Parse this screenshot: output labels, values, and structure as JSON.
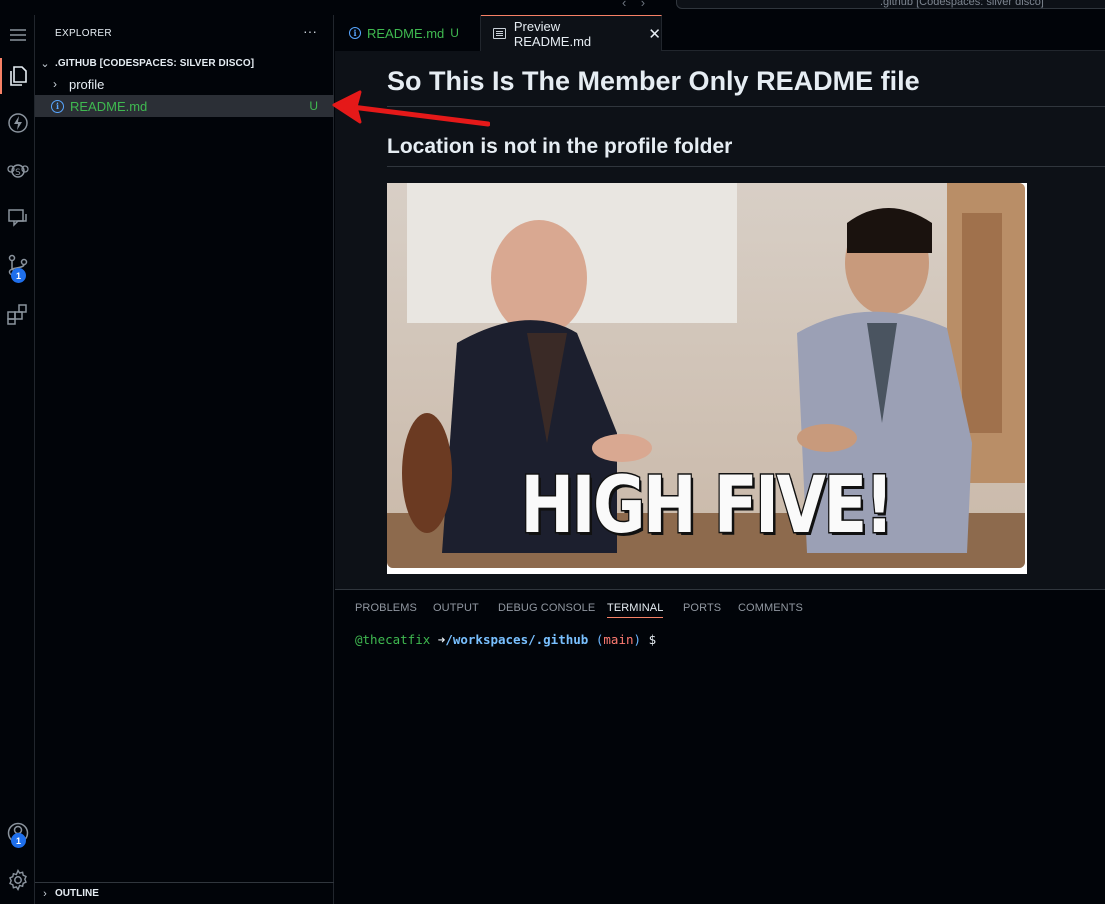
{
  "window": {
    "title_search_text": ".github [Codespaces: silver disco]"
  },
  "activity_bar": {
    "source_control_badge": "1",
    "accounts_badge": "1"
  },
  "sidebar": {
    "title": "EXPLORER",
    "more_label": "···",
    "folder_name": ".GITHUB [CODESPACES: SILVER DISCO]",
    "items": [
      {
        "label": "profile",
        "type": "folder"
      },
      {
        "label": "README.md",
        "type": "file",
        "status": "U"
      }
    ],
    "outline_label": "OUTLINE"
  },
  "tabs": [
    {
      "label": "README.md",
      "status": "U",
      "active": false
    },
    {
      "label": "Preview README.md",
      "active": true,
      "close": "✕"
    }
  ],
  "preview": {
    "h1": "So This Is The Member Only README file",
    "h2": "Location is not in the profile folder",
    "image_caption": "HIGH FIVE!"
  },
  "panel": {
    "tabs": [
      "PROBLEMS",
      "OUTPUT",
      "DEBUG CONSOLE",
      "TERMINAL",
      "PORTS",
      "COMMENTS"
    ],
    "active_tab": "TERMINAL",
    "terminal": {
      "user": "@thecatfix",
      "arrow": "➜",
      "path": "/workspaces/.github",
      "paren_open": "(",
      "branch": "main",
      "paren_close": ")",
      "prompt": "$"
    }
  },
  "colors": {
    "accent": "#f78166",
    "untracked": "#3fb950",
    "badge": "#1f6feb",
    "annotation_arrow": "#e51919"
  }
}
